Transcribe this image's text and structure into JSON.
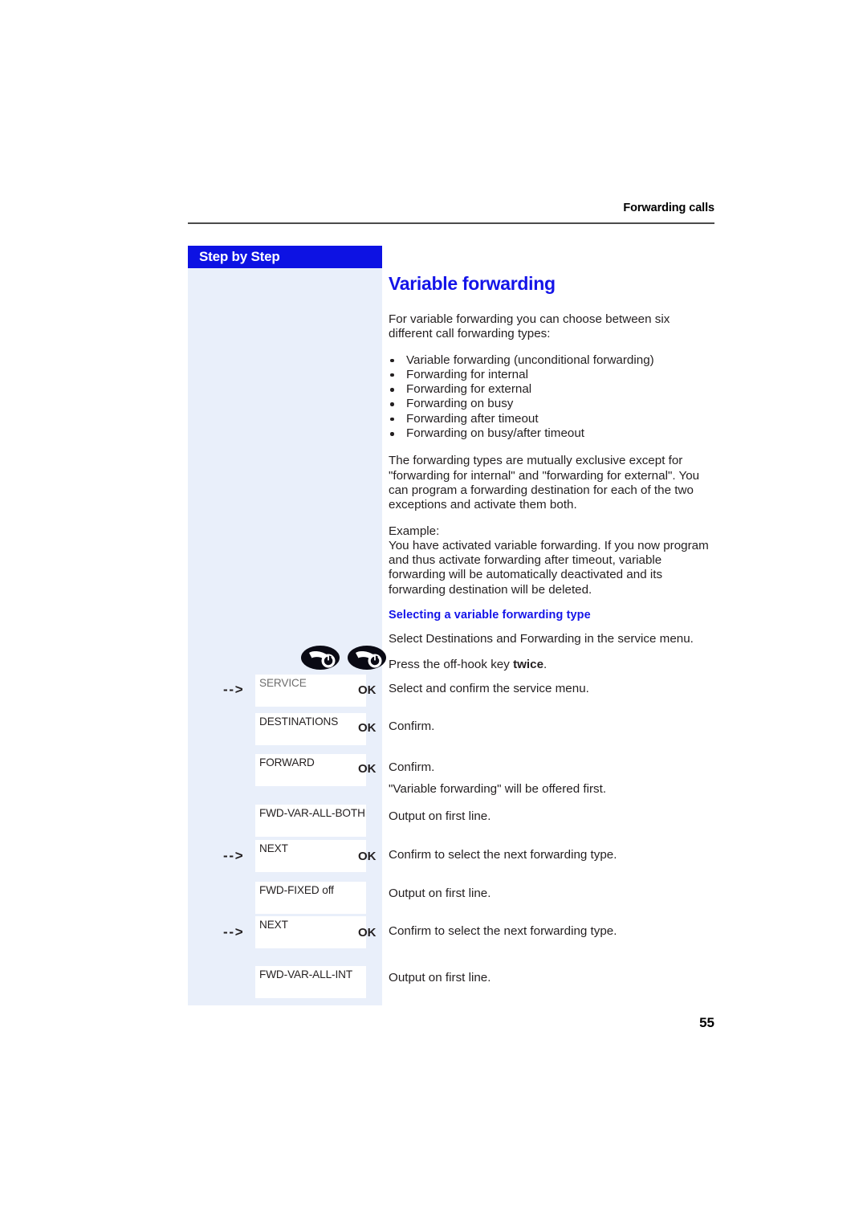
{
  "header": {
    "running_title": "Forwarding calls"
  },
  "sidebar": {
    "banner_label": "Step by Step",
    "background_color": "#e9effa",
    "banner_color": "#0d12e3"
  },
  "content": {
    "title": "Variable forwarding",
    "accent_color": "#1414e8",
    "intro": "For variable forwarding you can choose between six different call forwarding types:",
    "forwarding_types": [
      "Variable forwarding (unconditional forwarding)",
      "Forwarding for internal",
      "Forwarding for external",
      "Forwarding on busy",
      "Forwarding after timeout",
      "Forwarding on busy/after timeout"
    ],
    "exclusivity_note": "The forwarding types are mutually exclusive except for \"forwarding for internal\" and \"forwarding for external\". You can program a forwarding destination for each of the two exceptions and activate them both.",
    "example_label": "Example:",
    "example_text": "You have activated variable forwarding. If you now program and thus activate forwarding after timeout, variable forwarding will be automatically deactivated and its forwarding destination will be deleted.",
    "subsection_title": "Selecting a variable forwarding type",
    "subsection_intro": "Select Destinations and Forwarding in the service menu.",
    "offhook_instruction_prefix": "Press the off-hook key ",
    "offhook_instruction_bold": "twice",
    "offhook_instruction_suffix": "."
  },
  "steps": [
    {
      "arrow": "- - >",
      "has_arrow": true,
      "display": "SERVICE",
      "display_grey": true,
      "ok": "OK",
      "has_ok": true,
      "description": "Select and confirm the service menu.",
      "extra": ""
    },
    {
      "arrow": "",
      "has_arrow": false,
      "display": "DESTINATIONS",
      "display_grey": false,
      "ok": "OK",
      "has_ok": true,
      "description": "Confirm.",
      "extra": ""
    },
    {
      "arrow": "",
      "has_arrow": false,
      "display": "FORWARD",
      "display_grey": false,
      "ok": "OK",
      "has_ok": true,
      "description": "Confirm.",
      "extra": "\"Variable forwarding\" will be offered first."
    },
    {
      "arrow": "",
      "has_arrow": false,
      "display": "FWD-VAR-ALL-BOTH",
      "display_grey": false,
      "ok": "",
      "has_ok": false,
      "description": "Output on first line.",
      "extra": ""
    },
    {
      "arrow": "- - >",
      "has_arrow": true,
      "display": "NEXT",
      "display_grey": false,
      "ok": "OK",
      "has_ok": true,
      "description": "Confirm to select the next forwarding type.",
      "extra": ""
    },
    {
      "arrow": "",
      "has_arrow": false,
      "display": "FWD-FIXED off",
      "display_grey": false,
      "ok": "",
      "has_ok": false,
      "description": "Output on first line.",
      "extra": ""
    },
    {
      "arrow": "- - >",
      "has_arrow": true,
      "display": "NEXT",
      "display_grey": false,
      "ok": "OK",
      "has_ok": true,
      "description": "Confirm to select the next forwarding type.",
      "extra": ""
    },
    {
      "arrow": "",
      "has_arrow": false,
      "display": "FWD-VAR-ALL-INT",
      "display_grey": false,
      "ok": "",
      "has_ok": false,
      "description": "Output on first line.",
      "extra": ""
    }
  ],
  "icons": {
    "offhook_key_1": "offhook-key-icon",
    "offhook_key_2": "offhook-key-icon"
  },
  "footer": {
    "page_number": "55"
  }
}
